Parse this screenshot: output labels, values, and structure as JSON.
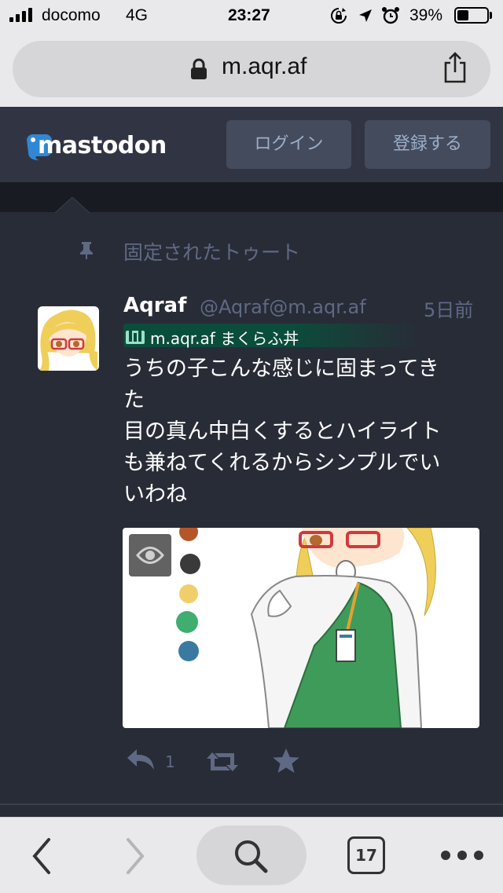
{
  "status_bar": {
    "carrier": "docomo",
    "network": "4G",
    "time": "23:27",
    "battery": "39%",
    "battery_level": 0.39
  },
  "browser": {
    "url": "m.aqr.af"
  },
  "mastodon": {
    "logo_text": "mastodon",
    "login_label": "ログイン",
    "signup_label": "登録する",
    "pinned_label": "固定されたトゥート"
  },
  "post": {
    "display_name": "Aqraf",
    "handle": "@Aqraf@m.aqr.af",
    "time_ago": "5日前",
    "instance_badge": "m.aqr.af まくらふ丼",
    "content_lines": [
      "うちの子こんな感じに固まってき",
      "た",
      "目の真ん中白くするとハイライト",
      "も兼ねてくれるからシンプルでい",
      "いわね"
    ],
    "reply_count": "1"
  },
  "colors": {
    "background": "#282c37",
    "header": "#313543",
    "button": "#444b5d",
    "muted": "#606984",
    "badge_start": "#0b4d3c",
    "palette": [
      "#b5562a",
      "#3a3a3a",
      "#f0cf6a",
      "#3fae6e",
      "#3a7aa0"
    ]
  },
  "bottom_bar": {
    "tab_count": "17"
  },
  "icons": {
    "status": [
      "signal-icon",
      "rotation-lock-icon",
      "location-icon",
      "alarm-icon",
      "battery-icon"
    ],
    "browser": [
      "lock-icon",
      "share-icon",
      "back-icon",
      "forward-icon",
      "search-icon",
      "tabs-icon",
      "more-icon"
    ],
    "post": [
      "pin-icon",
      "eye-icon",
      "reply-icon",
      "boost-icon",
      "favourite-icon"
    ]
  }
}
